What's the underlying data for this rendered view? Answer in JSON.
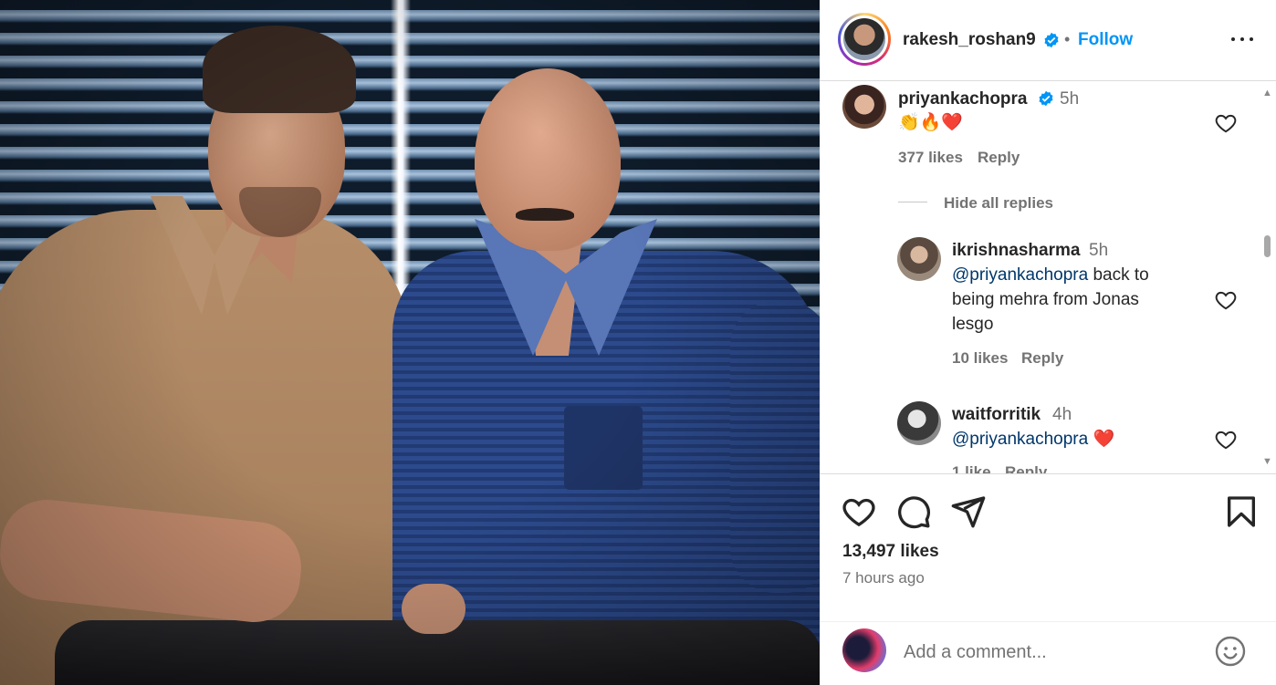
{
  "post": {
    "image_alt": "Two men posing together by a window with blinds",
    "author": {
      "username": "rakesh_roshan9",
      "verified": true,
      "follow_label": "Follow",
      "separator": "•"
    }
  },
  "comments": [
    {
      "username": "priyankachopra",
      "verified": true,
      "time": "5h",
      "text": "👏🔥❤️",
      "likes": "377 likes",
      "reply_label": "Reply",
      "toggle_label": "Hide all replies",
      "replies": [
        {
          "username": "ikrishnasharma",
          "time": "5h",
          "mention": "@priyankachopra",
          "text_line1": " back to",
          "text_line2": "being mehra from Jonas",
          "text_line3": "lesgo",
          "likes": "10 likes",
          "reply_label": "Reply"
        },
        {
          "username": "waitforritik",
          "time": "4h",
          "mention": "@priyankachopra",
          "text": " ❤️",
          "likes": "1 like",
          "reply_label": "Reply"
        }
      ]
    }
  ],
  "actions": {
    "icons": [
      "heart-icon",
      "comment-icon",
      "share-icon",
      "bookmark-icon"
    ],
    "likes": "13,497 likes",
    "time_ago": "7 hours ago"
  },
  "add_comment": {
    "placeholder": "Add a comment...",
    "emoji_icon": "emoji-icon"
  },
  "colors": {
    "link_blue": "#0095f6",
    "mention_blue": "#00376b",
    "verified_blue": "#0095f6",
    "heart_red": "#ff3040"
  }
}
